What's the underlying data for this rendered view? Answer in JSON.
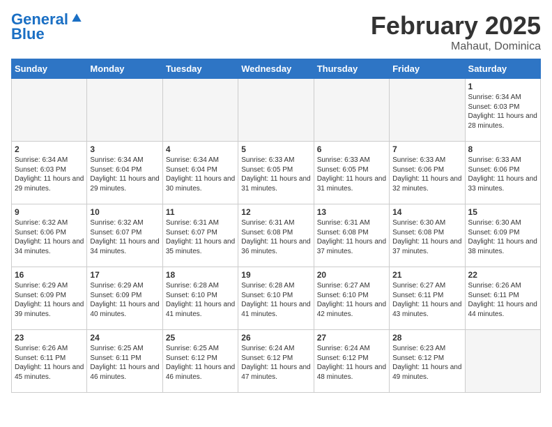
{
  "logo": {
    "line1": "General",
    "line2": "Blue"
  },
  "title": "February 2025",
  "location": "Mahaut, Dominica",
  "days_of_week": [
    "Sunday",
    "Monday",
    "Tuesday",
    "Wednesday",
    "Thursday",
    "Friday",
    "Saturday"
  ],
  "weeks": [
    [
      {
        "day": "",
        "empty": true
      },
      {
        "day": "",
        "empty": true
      },
      {
        "day": "",
        "empty": true
      },
      {
        "day": "",
        "empty": true
      },
      {
        "day": "",
        "empty": true
      },
      {
        "day": "",
        "empty": true
      },
      {
        "day": "1",
        "sunrise": "6:34 AM",
        "sunset": "6:03 PM",
        "daylight": "11 hours and 28 minutes."
      }
    ],
    [
      {
        "day": "2",
        "sunrise": "6:34 AM",
        "sunset": "6:03 PM",
        "daylight": "11 hours and 29 minutes."
      },
      {
        "day": "3",
        "sunrise": "6:34 AM",
        "sunset": "6:04 PM",
        "daylight": "11 hours and 29 minutes."
      },
      {
        "day": "4",
        "sunrise": "6:34 AM",
        "sunset": "6:04 PM",
        "daylight": "11 hours and 30 minutes."
      },
      {
        "day": "5",
        "sunrise": "6:33 AM",
        "sunset": "6:05 PM",
        "daylight": "11 hours and 31 minutes."
      },
      {
        "day": "6",
        "sunrise": "6:33 AM",
        "sunset": "6:05 PM",
        "daylight": "11 hours and 31 minutes."
      },
      {
        "day": "7",
        "sunrise": "6:33 AM",
        "sunset": "6:06 PM",
        "daylight": "11 hours and 32 minutes."
      },
      {
        "day": "8",
        "sunrise": "6:33 AM",
        "sunset": "6:06 PM",
        "daylight": "11 hours and 33 minutes."
      }
    ],
    [
      {
        "day": "9",
        "sunrise": "6:32 AM",
        "sunset": "6:06 PM",
        "daylight": "11 hours and 34 minutes."
      },
      {
        "day": "10",
        "sunrise": "6:32 AM",
        "sunset": "6:07 PM",
        "daylight": "11 hours and 34 minutes."
      },
      {
        "day": "11",
        "sunrise": "6:31 AM",
        "sunset": "6:07 PM",
        "daylight": "11 hours and 35 minutes."
      },
      {
        "day": "12",
        "sunrise": "6:31 AM",
        "sunset": "6:08 PM",
        "daylight": "11 hours and 36 minutes."
      },
      {
        "day": "13",
        "sunrise": "6:31 AM",
        "sunset": "6:08 PM",
        "daylight": "11 hours and 37 minutes."
      },
      {
        "day": "14",
        "sunrise": "6:30 AM",
        "sunset": "6:08 PM",
        "daylight": "11 hours and 37 minutes."
      },
      {
        "day": "15",
        "sunrise": "6:30 AM",
        "sunset": "6:09 PM",
        "daylight": "11 hours and 38 minutes."
      }
    ],
    [
      {
        "day": "16",
        "sunrise": "6:29 AM",
        "sunset": "6:09 PM",
        "daylight": "11 hours and 39 minutes."
      },
      {
        "day": "17",
        "sunrise": "6:29 AM",
        "sunset": "6:09 PM",
        "daylight": "11 hours and 40 minutes."
      },
      {
        "day": "18",
        "sunrise": "6:28 AM",
        "sunset": "6:10 PM",
        "daylight": "11 hours and 41 minutes."
      },
      {
        "day": "19",
        "sunrise": "6:28 AM",
        "sunset": "6:10 PM",
        "daylight": "11 hours and 41 minutes."
      },
      {
        "day": "20",
        "sunrise": "6:27 AM",
        "sunset": "6:10 PM",
        "daylight": "11 hours and 42 minutes."
      },
      {
        "day": "21",
        "sunrise": "6:27 AM",
        "sunset": "6:11 PM",
        "daylight": "11 hours and 43 minutes."
      },
      {
        "day": "22",
        "sunrise": "6:26 AM",
        "sunset": "6:11 PM",
        "daylight": "11 hours and 44 minutes."
      }
    ],
    [
      {
        "day": "23",
        "sunrise": "6:26 AM",
        "sunset": "6:11 PM",
        "daylight": "11 hours and 45 minutes."
      },
      {
        "day": "24",
        "sunrise": "6:25 AM",
        "sunset": "6:11 PM",
        "daylight": "11 hours and 46 minutes."
      },
      {
        "day": "25",
        "sunrise": "6:25 AM",
        "sunset": "6:12 PM",
        "daylight": "11 hours and 46 minutes."
      },
      {
        "day": "26",
        "sunrise": "6:24 AM",
        "sunset": "6:12 PM",
        "daylight": "11 hours and 47 minutes."
      },
      {
        "day": "27",
        "sunrise": "6:24 AM",
        "sunset": "6:12 PM",
        "daylight": "11 hours and 48 minutes."
      },
      {
        "day": "28",
        "sunrise": "6:23 AM",
        "sunset": "6:12 PM",
        "daylight": "11 hours and 49 minutes."
      },
      {
        "day": "",
        "empty": true
      }
    ]
  ]
}
